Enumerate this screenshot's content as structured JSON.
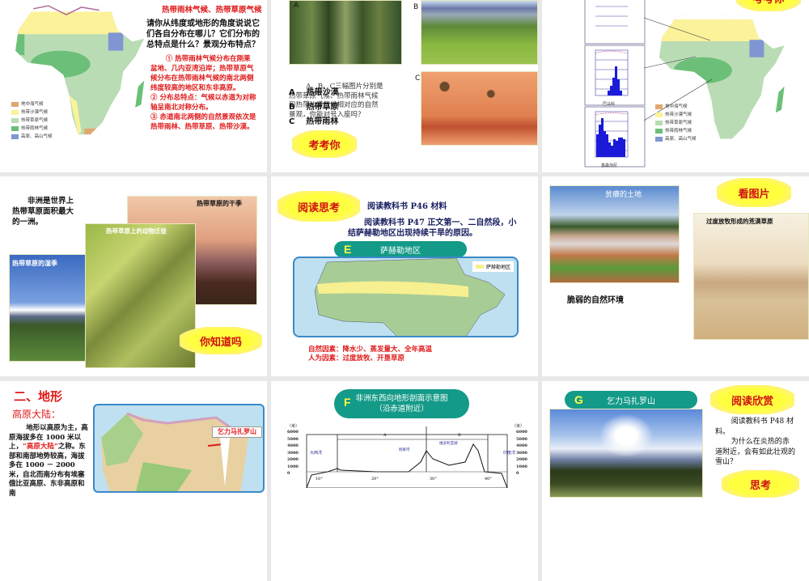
{
  "colors": {
    "slide_bg": "#ffffff",
    "sorter_bg": "#e8e8e8",
    "red": "#e01818",
    "teal": "#149a88",
    "cloud": "#ffff40"
  },
  "slides": [
    {
      "title": "热带雨林气候、热带草原气候",
      "question": "请你从纬度或地形的角度说说它们各自分布在哪儿？它们分布的总特点是什么？景观分布特点？",
      "answers": [
        "① 热带雨林气候分布在刚果盆地、几内亚湾沿岸；热带草原气候分布在热带雨林气候的南北两侧纬度较高的地区和东非高原。",
        "② 分布总特点：气候以赤道为对称轴呈南北对称分布。",
        "③ 赤道南北两侧的自然景观依次是热带雨林、热带草原、热带沙漠。"
      ],
      "legend": [
        "地中海气候",
        "热带沙漠气候",
        "热带草原气候",
        "热带雨林气候",
        "高原、高山气候"
      ]
    },
    {
      "photo_labels": [
        "A",
        "B",
        "C"
      ],
      "body": "A、B、C三幅图片分别是热带草原气候、热带雨林气候和热带沙漠气候相对应的自然景观，你能对号入座吗？",
      "answer_labels": [
        "A",
        "B",
        "C"
      ],
      "answer_values": [
        "热带沙漠",
        "热带草原",
        "热带雨林"
      ],
      "cloud": "考考你"
    },
    {
      "cloud": "考考你",
      "chart_captions": [
        "巴马科",
        "基桑加尼"
      ],
      "legend": [
        "地中海气候",
        "热带沙漠气候",
        "热带草原气候",
        "热带雨林气候",
        "高原、高山气候"
      ]
    },
    {
      "text": "非洲是世界上热带草原面积最大的一洲。",
      "captions": [
        "热带草原的干季",
        "热带草原上的动物迁徙",
        "热带草原的湿季"
      ],
      "cloud": "你知道吗"
    },
    {
      "cloud": "阅读思考",
      "line1": "阅读教科书 P46 材料",
      "line2": "阅读教科书 P47 正文第一、二自然段，小结萨赫勒地区出现持续干旱的原因。",
      "pill_letter": "E",
      "pill_text": "萨赫勒地区",
      "map_legend": "萨赫勒地区",
      "factors": [
        "自然因素：降水少、蒸发量大、全年高温",
        "人为因素：过度放牧、开垦草原"
      ]
    },
    {
      "photo1_caption": "贫瘠的土地",
      "text": "脆弱的自然环境",
      "cloud": "看图片",
      "photo2_caption": "过度放牧形成的荒漠草原"
    },
    {
      "heading": "二、地形",
      "subheading": "高原大陆：",
      "para_a": "地形以高原为主，高原海拔多在 1000 米以上，",
      "para_quote": "“高原大陆”",
      "para_b": "之称。东部和南部地势较高，海拔多在 1000 － 2000 米，自北而南分布有埃塞俄比亚高原、东非高原和南",
      "map_label": "乞力马扎罗山"
    },
    {
      "pill_letter": "F",
      "pill_title": "非洲东西向地形剖面示意图",
      "pill_subtitle": "（沿赤道附近）",
      "unit": "（米）",
      "y_ticks": [
        "6000",
        "5000",
        "4000",
        "3000",
        "2000",
        "1000",
        "0"
      ],
      "x_ticks": [
        "10°",
        "20°",
        "30°",
        "40°"
      ],
      "sections": [
        "A",
        "B"
      ],
      "places": [
        "大西洋",
        "刚果河",
        "维多利亚湖",
        "印度洋"
      ]
    },
    {
      "pill_letter": "G",
      "pill_text": "乞力马扎罗山",
      "cloud": "阅读欣赏",
      "p1": "阅读教科书 P48 材料。",
      "p2": "为什么在炎热的赤道附近，会有如此壮观的雪山？",
      "cloud2": "思考"
    }
  ]
}
